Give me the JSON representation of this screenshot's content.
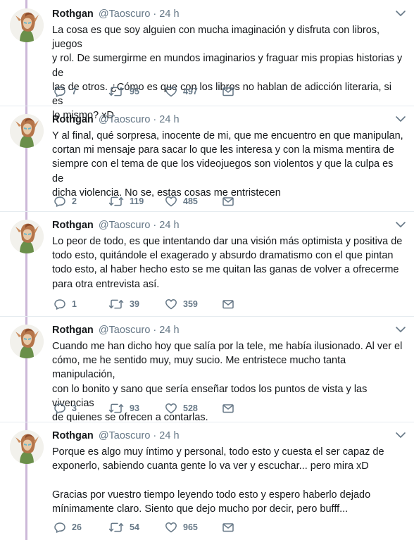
{
  "colors": {
    "text": "#14171a",
    "muted": "#657786",
    "thread_line": "#ccb8d8",
    "divider": "#e6ecf0"
  },
  "tweets": [
    {
      "name": "Rothgan",
      "handle": "@Taoscuro",
      "separator": "·",
      "time": "24 h",
      "text": "La cosa es que soy alguien con mucha imaginación y disfruta con libros, juegos\ny rol. De sumergirme en mundos imaginarios y fraguar mis propias historias y de\nlas de otros. ¿Cómo es que con los libros no hablan de adicción literaria, si es\nlo mismo? xD",
      "replies": "7",
      "retweets": "95",
      "likes": "497"
    },
    {
      "name": "Rothgan",
      "handle": "@Taoscuro",
      "separator": "·",
      "time": "24 h",
      "text": "Y al final, qué sorpresa, inocente de mi, que me encuentro en que manipulan,\ncortan mi mensaje para sacar lo que les interesa y con la misma mentira de\nsiempre con el tema de que los videojuegos son violentos y que la culpa es de\ndicha violencia. No se, estas cosas me entristecen",
      "replies": "2",
      "retweets": "119",
      "likes": "485"
    },
    {
      "name": "Rothgan",
      "handle": "@Taoscuro",
      "separator": "·",
      "time": "24 h",
      "text": "Lo peor de todo, es que intentando dar una visión más optimista y positiva de\ntodo esto, quitándole el exagerado y absurdo dramatismo con el que pintan\ntodo esto, al haber hecho esto se me quitan las ganas de volver a ofrecerme\npara otra entrevista así.",
      "replies": "1",
      "retweets": "39",
      "likes": "359"
    },
    {
      "name": "Rothgan",
      "handle": "@Taoscuro",
      "separator": "·",
      "time": "24 h",
      "text": "Cuando me han dicho hoy que salía por la tele, me había ilusionado. Al ver el\ncómo, me he sentido muy, muy sucio. Me entristece mucho tanta manipulación,\ncon lo bonito y sano que sería enseñar todos los puntos de vista y las vivencias\nde quienes se ofrecen a contarlas.",
      "replies": "3",
      "retweets": "93",
      "likes": "528"
    },
    {
      "name": "Rothgan",
      "handle": "@Taoscuro",
      "separator": "·",
      "time": "24 h",
      "text": "Porque es algo muy íntimo y personal, todo esto y cuesta el ser capaz de\nexponerlo, sabiendo cuanta gente lo va ver y escuchar... pero mira xD\n\nGracias por vuestro tiempo leyendo todo esto y espero haberlo dejado\nmínimamente claro. Siento que dejo mucho por decir, pero bufff...",
      "replies": "26",
      "retweets": "54",
      "likes": "965"
    }
  ]
}
